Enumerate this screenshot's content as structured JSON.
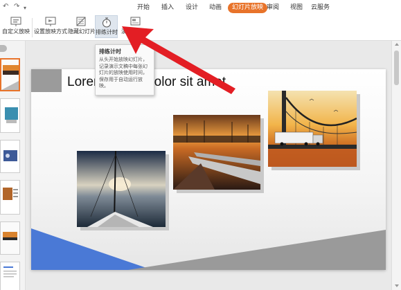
{
  "quick_access": {
    "undo_icon": "undo-icon",
    "redo_icon": "redo-icon",
    "more_icon": "chevron-down-icon"
  },
  "menu": {
    "tabs": [
      {
        "label": "开始"
      },
      {
        "label": "插入"
      },
      {
        "label": "设计"
      },
      {
        "label": "动画"
      },
      {
        "label": "幻灯片放映",
        "active": true
      },
      {
        "label": "审阅"
      },
      {
        "label": "视图"
      },
      {
        "label": "云服务"
      }
    ],
    "active_color": "#e8732a"
  },
  "ribbon": {
    "buttons": [
      {
        "label": "自定义放映",
        "icon": "custom-show-icon"
      },
      {
        "label": "设置放映方式",
        "icon": "setup-show-icon"
      },
      {
        "label": "隐藏幻灯片",
        "icon": "hide-slide-icon"
      },
      {
        "label": "排练计时",
        "icon": "stopwatch-icon",
        "hovered": true
      },
      {
        "label": "演讲者备注",
        "icon": "speaker-notes-icon"
      }
    ]
  },
  "tooltip": {
    "title": "排练计时",
    "body": "从头开始放映幻灯片，记录演示文稿中每张幻灯片的放映使用时间，保存用于自动运行放映。"
  },
  "slide": {
    "title": "Lorem ipsum dolor sit amet",
    "photos": [
      "sailboat-photo",
      "train-station-photo",
      "bridge-truck-photo"
    ]
  },
  "thumbnails": {
    "selected_index": 0,
    "count": 6
  }
}
